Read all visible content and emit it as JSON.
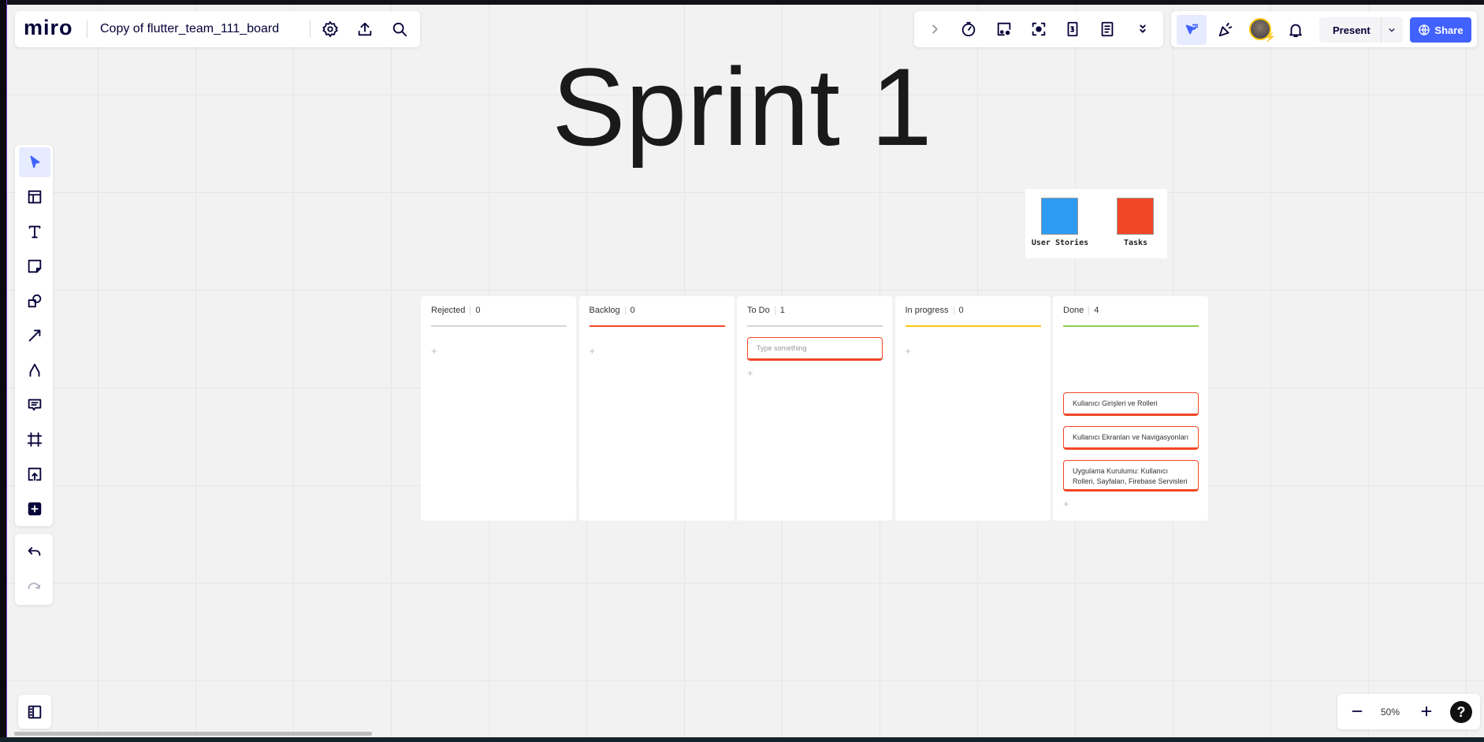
{
  "app": {
    "logo": "miro",
    "board_title": "Copy of flutter_team_111_board"
  },
  "header_icons": [
    "settings-icon",
    "upload-icon",
    "search-icon"
  ],
  "toolbar_icons": [
    "chevron-right-icon",
    "timer-icon",
    "card-icon",
    "focus-icon",
    "counter-icon",
    "notes-icon",
    "double-chevron-down-icon"
  ],
  "right": {
    "present_label": "Present",
    "share_label": "Share",
    "accent": "#4262ff"
  },
  "canvas": {
    "title": "Sprint 1",
    "legend": [
      {
        "label": "User Stories",
        "color": "#2d9bf0"
      },
      {
        "label": "Tasks",
        "color": "#f24726"
      }
    ]
  },
  "kanban": {
    "columns": [
      {
        "name": "Rejected",
        "count": "0",
        "color": "#d6d6d6",
        "cards": []
      },
      {
        "name": "Backlog",
        "count": "0",
        "color": "#f24726",
        "cards": []
      },
      {
        "name": "To Do",
        "count": "1",
        "color": "#d6d6d6",
        "cards": [
          {
            "text": "Type something",
            "placeholder": true
          }
        ]
      },
      {
        "name": "In progress",
        "count": "0",
        "color": "#fac710",
        "cards": []
      },
      {
        "name": "Done",
        "count": "4",
        "color": "#8fd14f",
        "cards": [
          {
            "text": "Kullanıcı Girişleri ve Rolleri"
          },
          {
            "text": "Kullanıcı Ekranları ve Navigasyonları"
          },
          {
            "text": "Uygulama Kurulumu: Kullanıcı Rolleri, Sayfaları, Firebase Servisleri"
          }
        ]
      }
    ]
  },
  "zoom": {
    "level": "50%"
  },
  "help_label": "?"
}
